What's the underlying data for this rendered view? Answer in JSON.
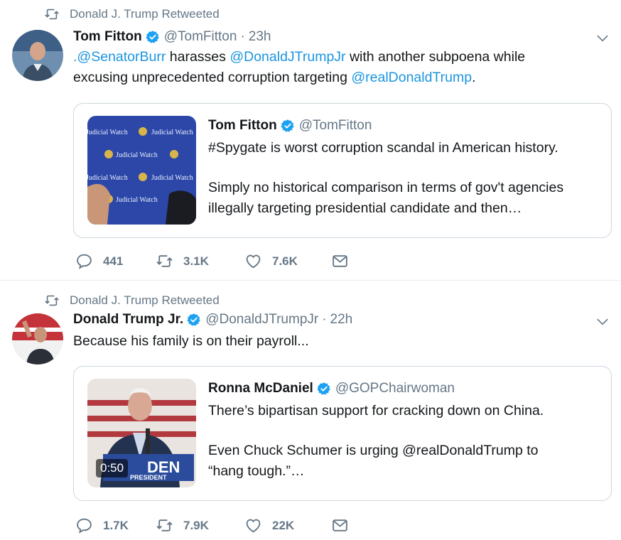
{
  "tweets": [
    {
      "retweet_label": "Donald J. Trump Retweeted",
      "author": {
        "name": "Tom Fitton",
        "handle": "@TomFitton",
        "time": "23h"
      },
      "text_parts": {
        "m1": ".@SenatorBurr",
        "t1": " harasses ",
        "m2": "@DonaldJTrumpJr",
        "t2": " with another subpoena while",
        "t3": "excusing unprecedented corruption targeting ",
        "m3": "@realDonaldTrump",
        "t4": "."
      },
      "quote": {
        "name": "Tom Fitton",
        "handle": "@TomFitton",
        "line1": "#Spygate is worst corruption scandal in American history.",
        "line2": "Simply no historical comparison in terms of gov't agencies",
        "line3": "illegally targeting presidential candidate and then…",
        "media_text": "Judicial Watch"
      },
      "actions": {
        "replies": "441",
        "retweets": "3.1K",
        "likes": "7.6K"
      }
    },
    {
      "retweet_label": "Donald J. Trump Retweeted",
      "author": {
        "name": "Donald Trump Jr.",
        "handle": "@DonaldJTrumpJr",
        "time": "22h"
      },
      "text": "Because his family is on their payroll...",
      "quote": {
        "name": "Ronna McDaniel",
        "handle": "@GOPChairwoman",
        "line1": "There’s bipartisan support for cracking down on China.",
        "line2": "Even Chuck Schumer is urging @realDonaldTrump to",
        "line3": "“hang tough.”…",
        "video_time": "0:50",
        "sign_text": "DEN",
        "sign_sub": "PRESIDENT"
      },
      "actions": {
        "replies": "1.7K",
        "retweets": "7.9K",
        "likes": "22K"
      }
    }
  ],
  "colors": {
    "link": "#1b95e0",
    "muted": "#657786",
    "border": "#ccd6dd"
  }
}
